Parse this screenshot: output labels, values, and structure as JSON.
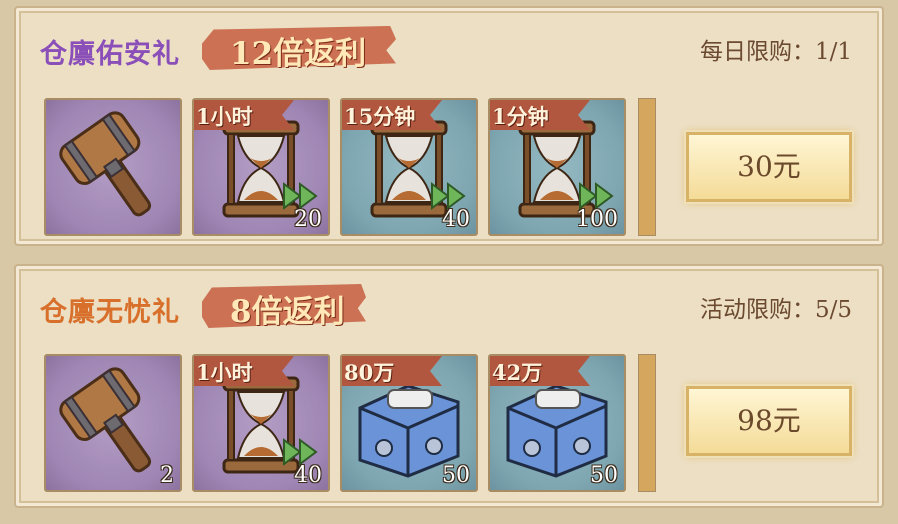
{
  "packs": [
    {
      "title": "仓廪佑安礼",
      "multiplier": "12倍返利",
      "limit": "每日限购：1/1",
      "price": "30元",
      "items": [
        {
          "icon": "hammer-icon",
          "tag": "",
          "qty": ""
        },
        {
          "icon": "hourglass-icon",
          "tag": "1小时",
          "qty": "20"
        },
        {
          "icon": "hourglass-icon",
          "tag": "15分钟",
          "qty": "40"
        },
        {
          "icon": "hourglass-icon",
          "tag": "1分钟",
          "qty": "100"
        }
      ]
    },
    {
      "title": "仓廪无忧礼",
      "multiplier": "8倍返利",
      "limit": "活动限购：5/5",
      "price": "98元",
      "items": [
        {
          "icon": "hammer-icon",
          "tag": "",
          "qty": "2"
        },
        {
          "icon": "hourglass-icon",
          "tag": "1小时",
          "qty": "40"
        },
        {
          "icon": "treasure-chest-icon",
          "tag": "80万",
          "qty": "50"
        },
        {
          "icon": "treasure-chest-icon",
          "tag": "42万",
          "qty": "50"
        }
      ]
    }
  ],
  "colors": {
    "title_purple": "#8a4fb8",
    "title_orange": "#d8702c",
    "ribbon": "#c9674a",
    "panel_bg": "#ecdfc4"
  }
}
